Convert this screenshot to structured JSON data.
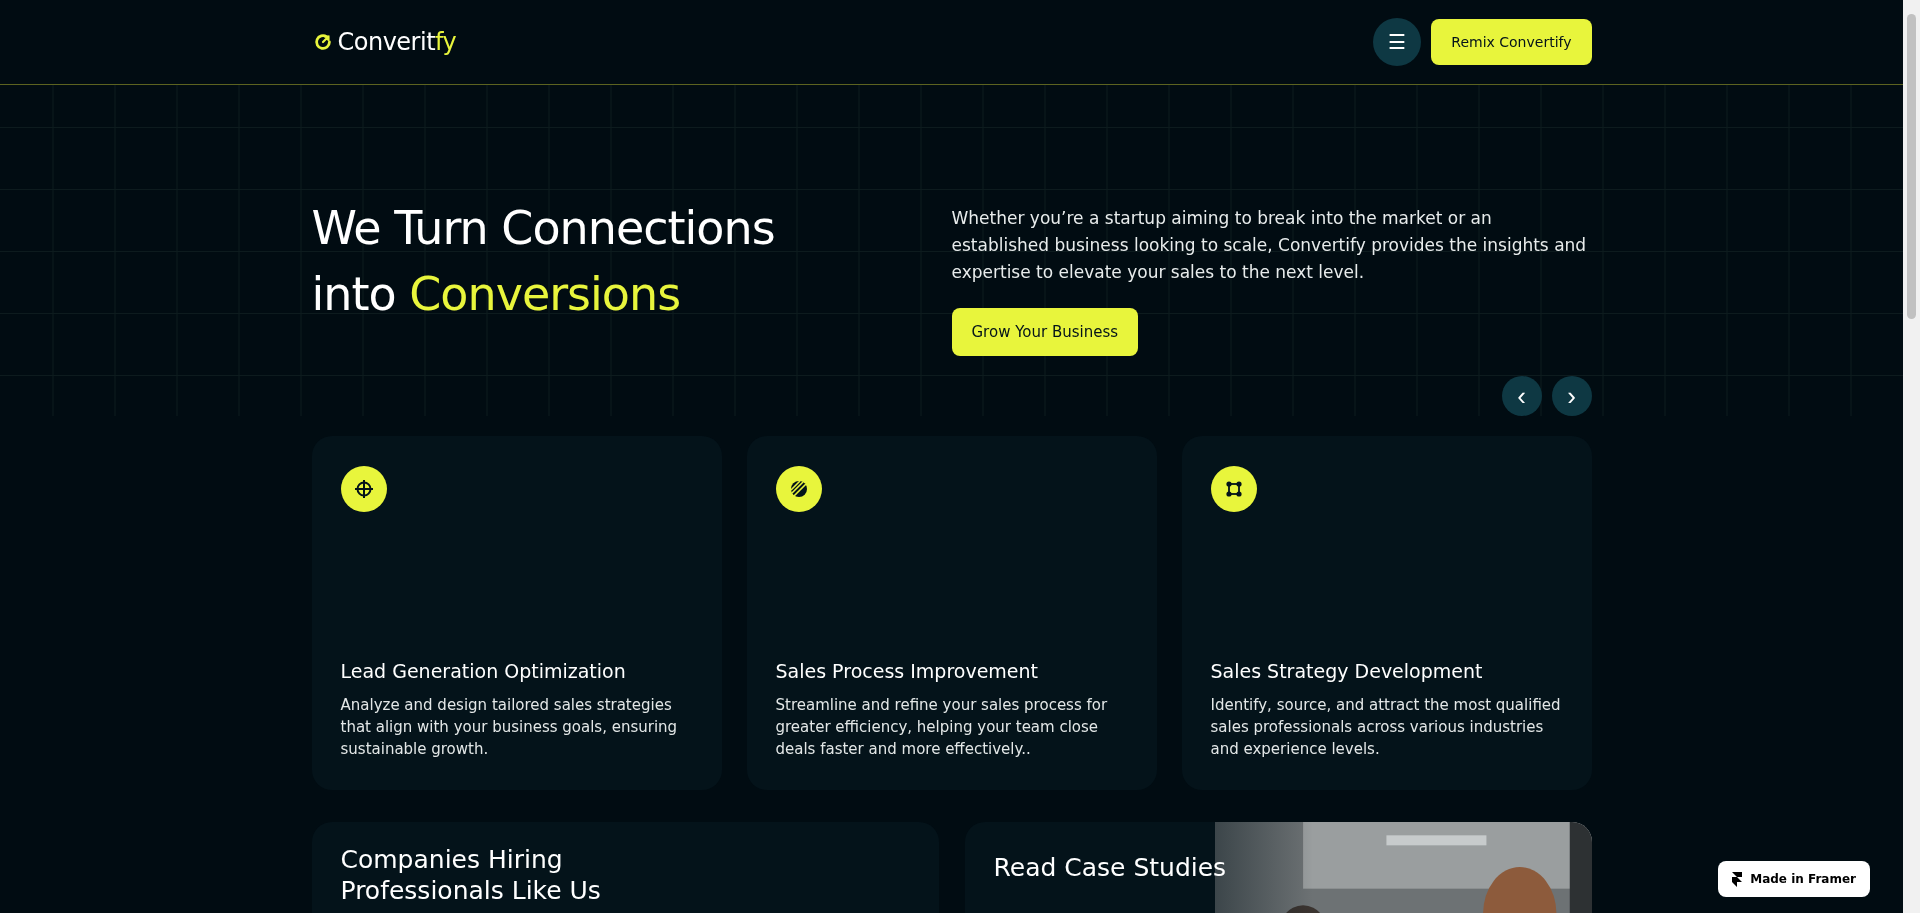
{
  "header": {
    "logo": {
      "text": "Converit",
      "accent": "fy"
    },
    "menu_button": "☰",
    "cta": "Remix Convertify"
  },
  "hero": {
    "title_line1": "We Turn Connections",
    "title_line2_plain": "into",
    "title_line2_accent": "Conversions",
    "description": "Whether you’re a startup aiming to break into the market or an established business looking to scale, Convertify provides the insights and expertise to elevate your sales to the next level.",
    "button": "Grow Your Business"
  },
  "carousel": {
    "prev": "‹",
    "next": "›"
  },
  "services": [
    {
      "kind": "target",
      "title": "Lead Generation Optimization",
      "description": "Analyze and design tailored sales strategies that align with your business goals, ensuring sustainable growth."
    },
    {
      "kind": "stripes",
      "title": "Sales Process Improvement",
      "description": "Streamline and refine your sales process for greater efficiency, helping your team close deals faster and more effectively.."
    },
    {
      "kind": "nodes",
      "title": "Sales Strategy Development",
      "description": "Identify, source, and attract the most qualified sales professionals across various industries and experience levels."
    }
  ],
  "bottom_cards": [
    {
      "kind": "plain",
      "title": "Companies Hiring Professionals Like Us"
    },
    {
      "kind": "picture",
      "title": "Read Case Studies"
    }
  ],
  "badge": "Made in Framer"
}
